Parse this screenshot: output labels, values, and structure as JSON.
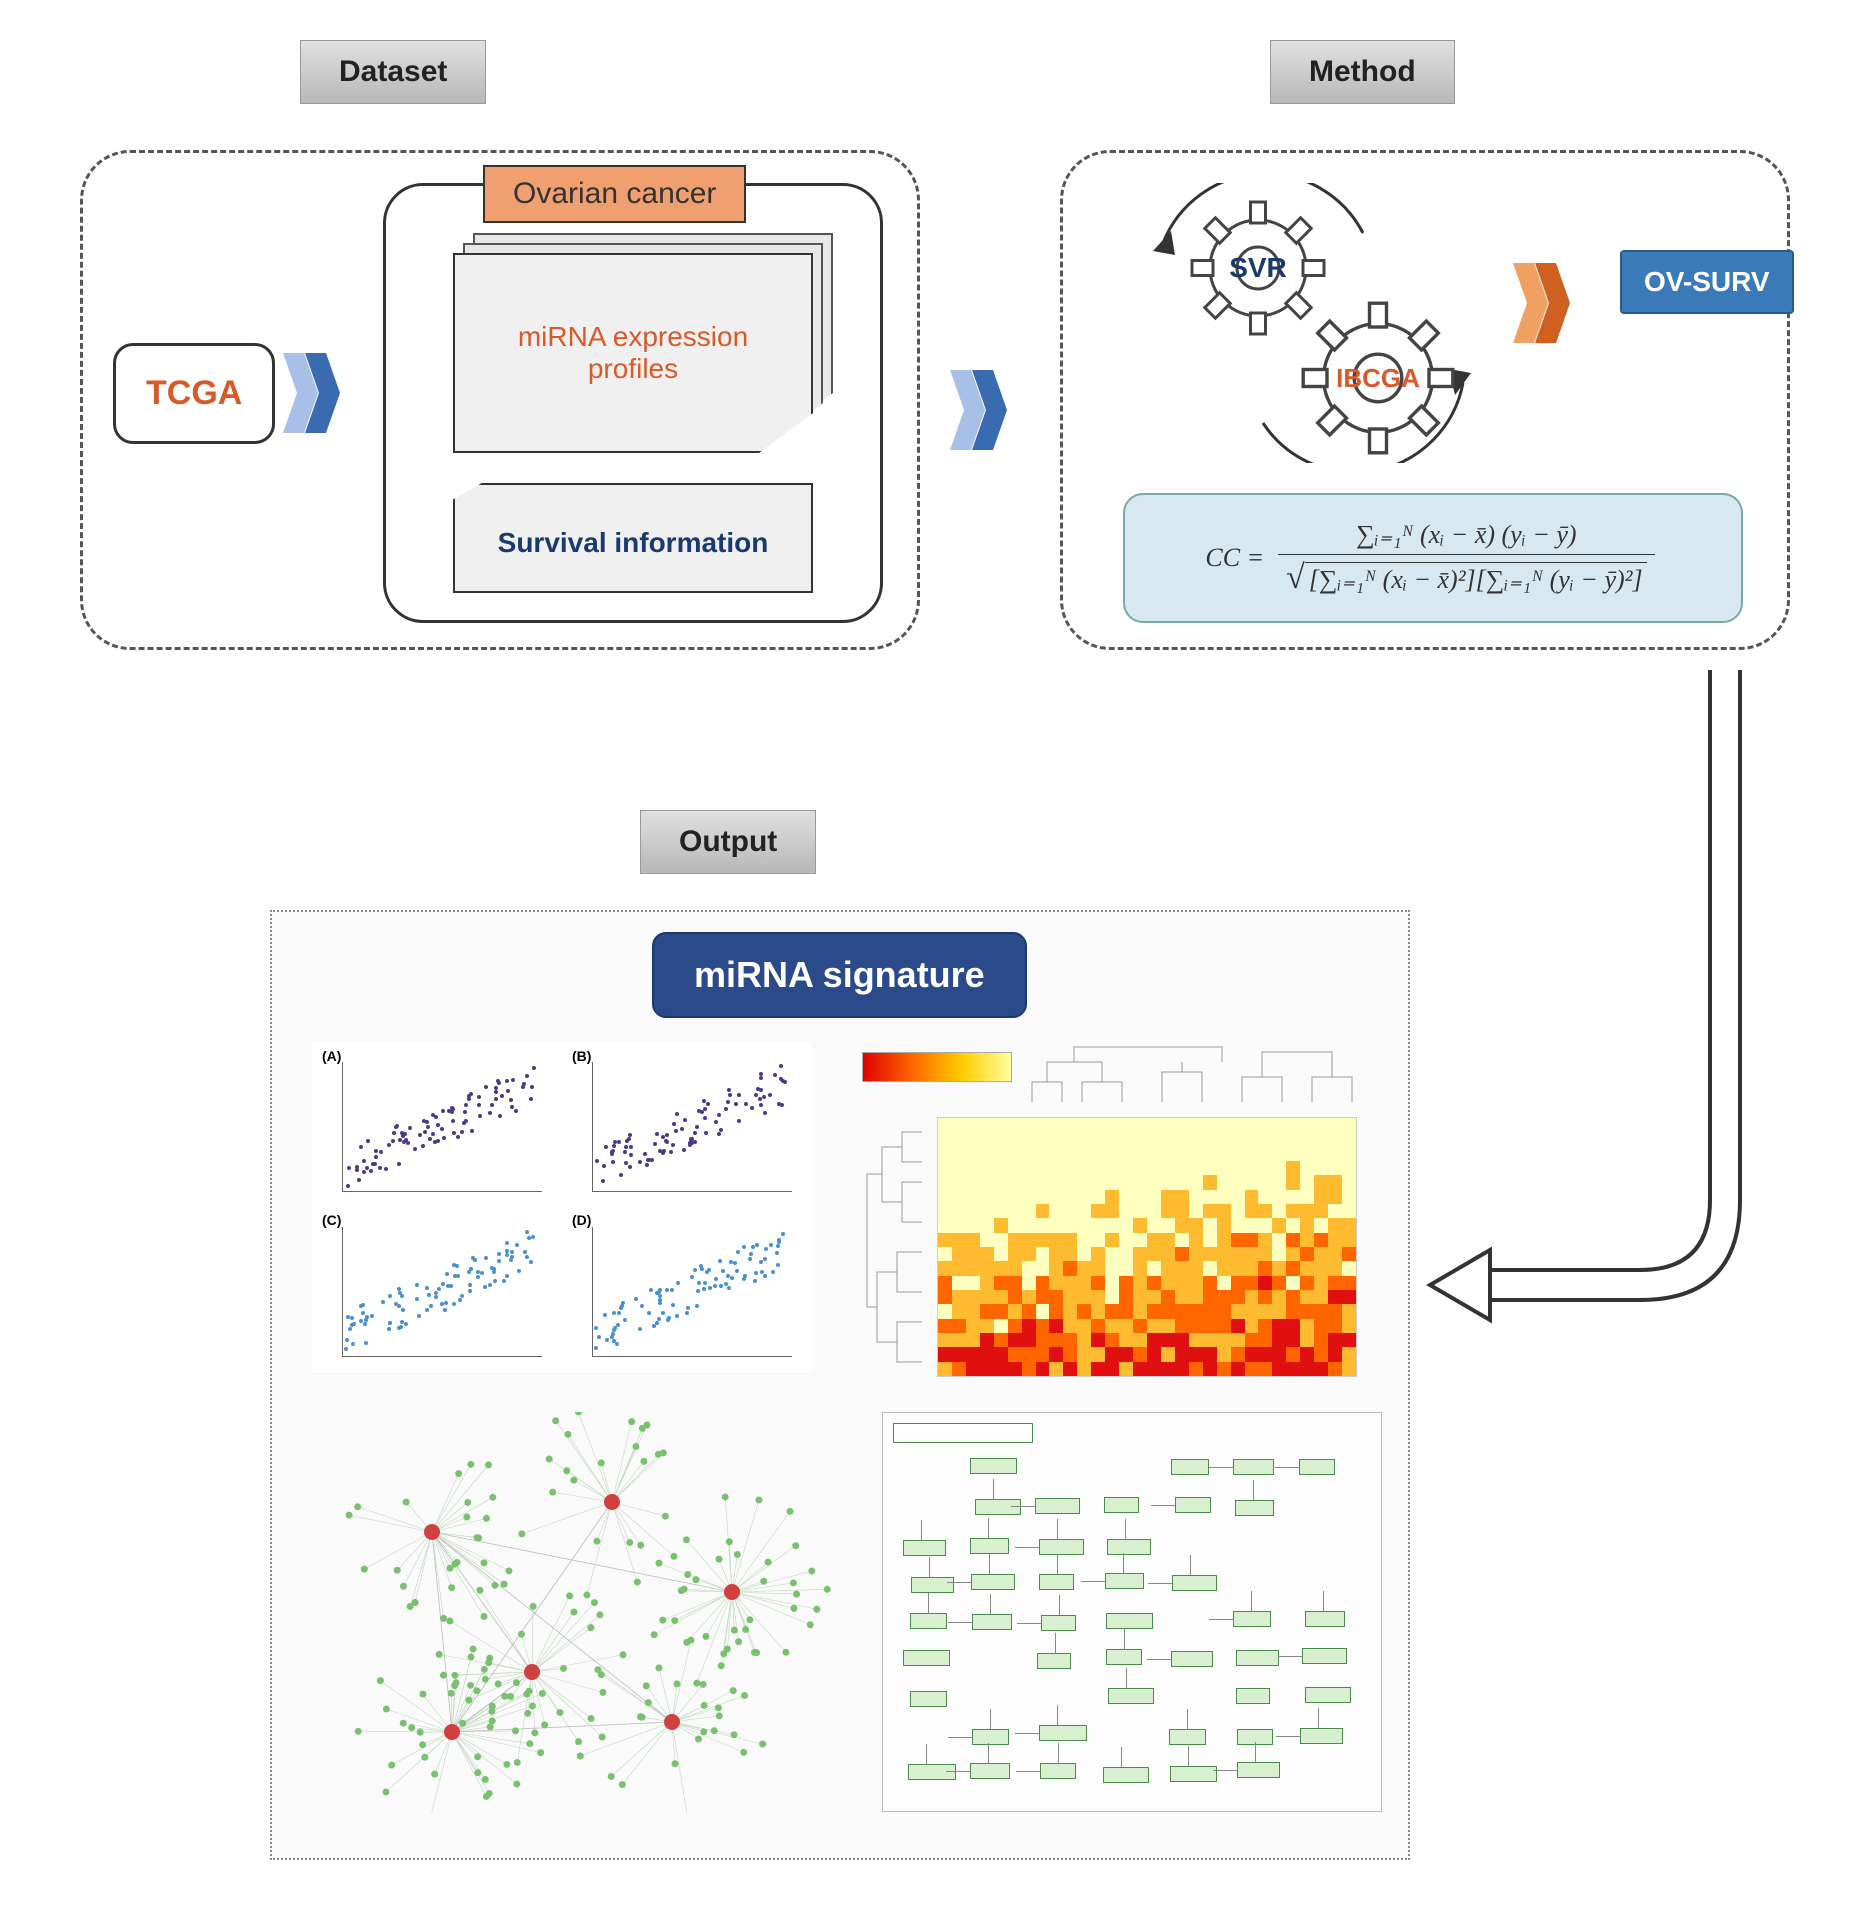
{
  "sections": {
    "dataset": "Dataset",
    "method": "Method",
    "output": "Output"
  },
  "dataset_panel": {
    "source": "TCGA",
    "cancer_type": "Ovarian cancer",
    "doc_label": "miRNA expression profiles",
    "note_label": "Survival information"
  },
  "method_panel": {
    "gear_top": "SVR",
    "gear_bottom": "IBCGA",
    "result_label": "OV-SURV",
    "formula_lhs": "CC =",
    "formula_num": "∑ᵢ₌₁ᴺ (xᵢ − x̄) (yᵢ − ȳ)",
    "formula_den_left": "∑ᵢ₌₁ᴺ (xᵢ − x̄)²",
    "formula_den_right": "∑ᵢ₌₁ᴺ (yᵢ − ȳ)²"
  },
  "output_panel": {
    "badge": "miRNA signature",
    "scatter_labels": [
      "(A)",
      "(B)",
      "(C)",
      "(D)"
    ]
  },
  "chart_data": {
    "type": "diagram",
    "description": "Workflow diagram showing TCGA dataset (miRNA expression profiles and survival information for ovarian cancer) feeding into a method combining SVR and IBCGA optimized by correlation coefficient CC, producing OV-SURV, which outputs a miRNA signature visualized as scatter plots, heatmap, interaction network, and pathway map.",
    "nodes": [
      {
        "id": "dataset",
        "label": "Dataset",
        "children": [
          "TCGA",
          "Ovarian cancer",
          "miRNA expression profiles",
          "Survival information"
        ]
      },
      {
        "id": "method",
        "label": "Method",
        "children": [
          "SVR",
          "IBCGA",
          "CC formula",
          "OV-SURV"
        ]
      },
      {
        "id": "output",
        "label": "Output",
        "children": [
          "miRNA signature",
          "scatter plots",
          "heatmap",
          "network",
          "pathway"
        ]
      }
    ],
    "edges": [
      {
        "from": "dataset",
        "to": "method"
      },
      {
        "from": "method",
        "to": "OV-SURV"
      },
      {
        "from": "method",
        "to": "output"
      }
    ],
    "formula": "CC = Σ(x_i - x̄)(y_i - ȳ) / sqrt[Σ(x_i - x̄)²][Σ(y_i - ȳ)²]"
  }
}
